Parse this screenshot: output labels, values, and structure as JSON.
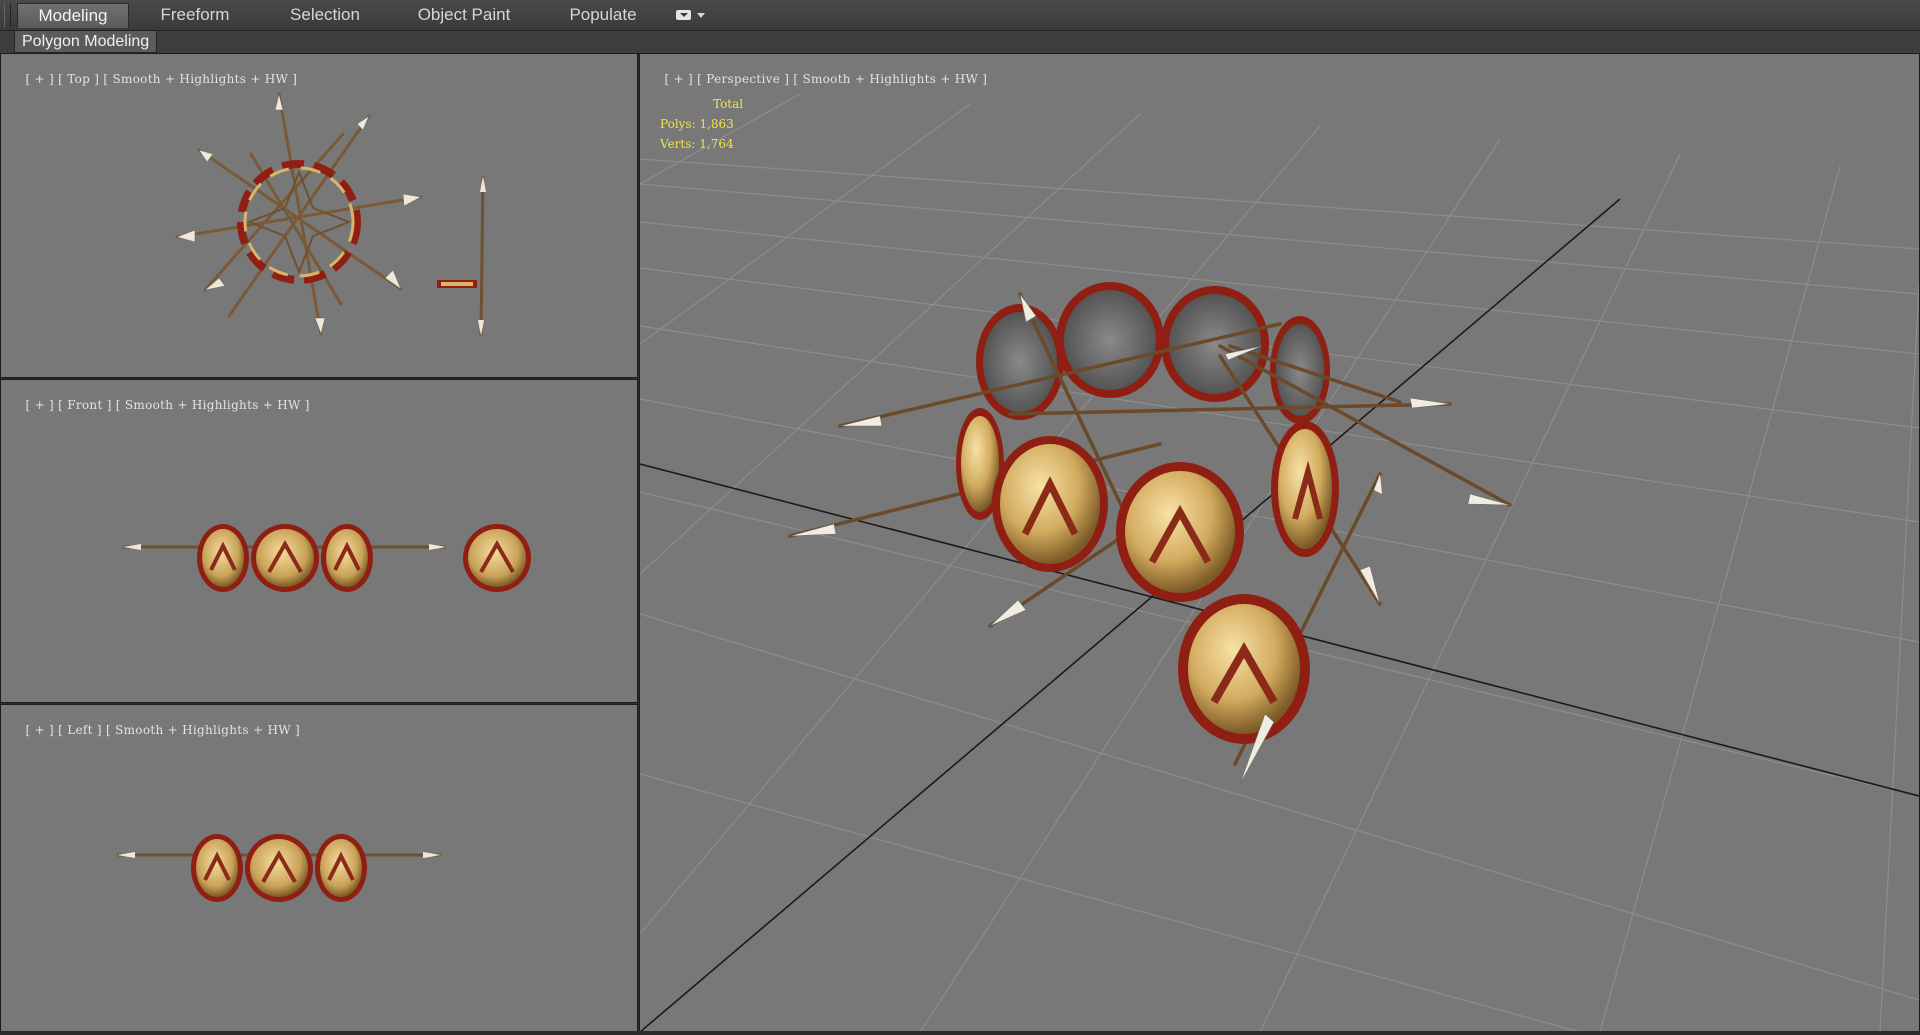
{
  "ribbon": {
    "tabs": [
      {
        "label": "Modeling",
        "active": true
      },
      {
        "label": "Freeform",
        "active": false
      },
      {
        "label": "Selection",
        "active": false
      },
      {
        "label": "Object Paint",
        "active": false
      },
      {
        "label": "Populate",
        "active": false
      }
    ],
    "options_icon": "ribbon-options-icon"
  },
  "subpanel": {
    "active_label": "Polygon Modeling"
  },
  "viewports": {
    "top": {
      "plus": "[ + ]",
      "name": "[ Top ]",
      "shading": "[ Smooth + Highlights + HW ]"
    },
    "front": {
      "plus": "[ + ]",
      "name": "[ Front ]",
      "shading": "[ Smooth + Highlights + HW ]"
    },
    "left": {
      "plus": "[ + ]",
      "name": "[ Left ]",
      "shading": "[ Smooth + Highlights + HW ]"
    },
    "perspective": {
      "plus": "[ + ]",
      "name": "[ Perspective ]",
      "shading": "[ Smooth + Highlights + HW ]",
      "stats": {
        "header": "Total",
        "polys": "Polys: 1,863",
        "verts": "Verts: 1,764"
      }
    }
  },
  "colors": {
    "viewport_bg": "#787878",
    "grid_line": "#8a8a8a",
    "stats_text": "#f0e44a",
    "shield_gold": "#d9b56a",
    "shield_rim": "#8f1f12",
    "lambda": "#8a2a18"
  }
}
